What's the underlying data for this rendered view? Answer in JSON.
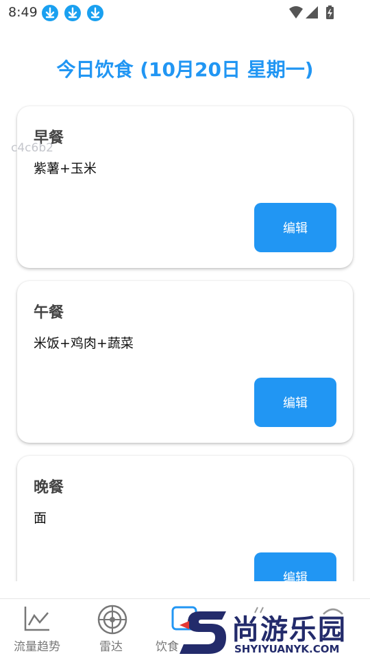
{
  "status": {
    "time": "8:49"
  },
  "page": {
    "title": "今日饮食 (10月20日 星期一)"
  },
  "meals": [
    {
      "title": "早餐",
      "desc": "紫薯+玉米",
      "edit": "编辑"
    },
    {
      "title": "午餐",
      "desc": "米饭+鸡肉+蔬菜",
      "edit": "编辑"
    },
    {
      "title": "晚餐",
      "desc": "面",
      "edit": "编辑"
    }
  ],
  "overlay_text": "c4c6b2",
  "nav": [
    {
      "label": "流量趋势",
      "icon": "trend-chart-icon"
    },
    {
      "label": "雷达",
      "icon": "radar-icon"
    },
    {
      "label": "饮食",
      "icon": "diet-icon"
    },
    {
      "label": "",
      "icon": "unknown-icon"
    },
    {
      "label": "",
      "icon": "unknown-icon"
    }
  ],
  "brand": {
    "name": "尚游乐园",
    "url": "SHYIYUANYK.COM"
  },
  "colors": {
    "accent": "#2196F3",
    "brand": "#232b6b",
    "brand_red": "#e53935"
  }
}
